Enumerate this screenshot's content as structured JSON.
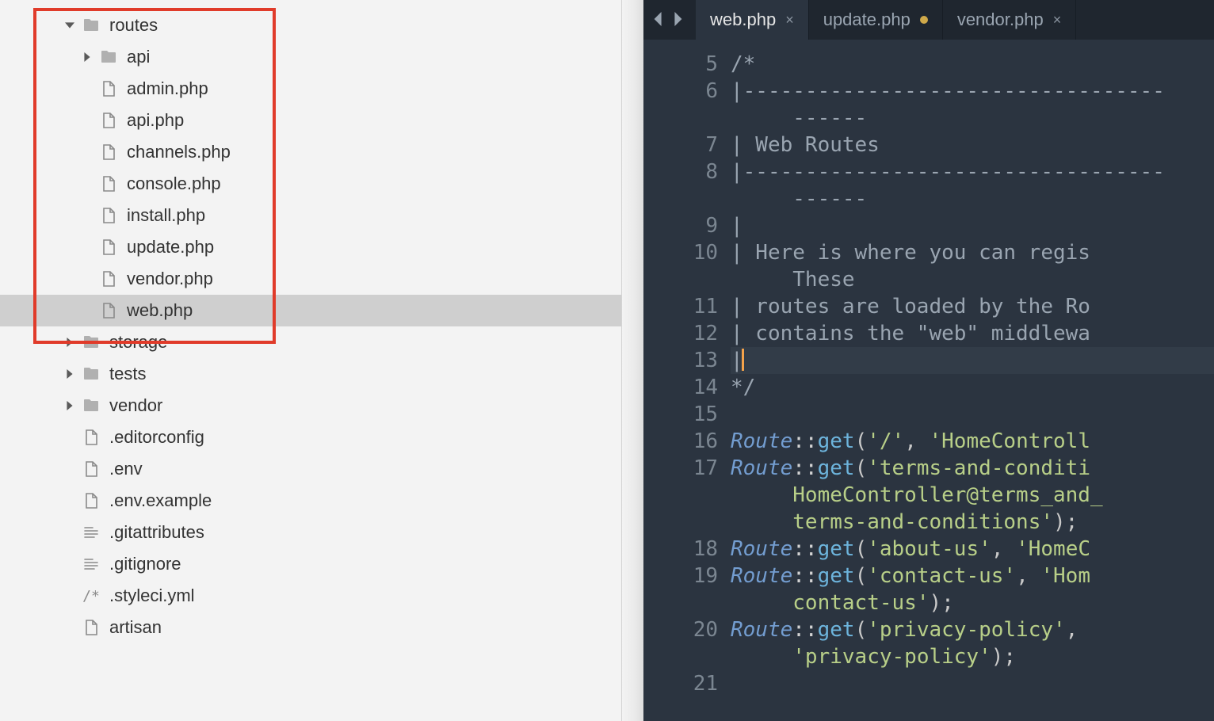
{
  "sidebar": {
    "tree": [
      {
        "depth": 2,
        "type": "folder",
        "expanded": true,
        "name": "routes"
      },
      {
        "depth": 3,
        "type": "folder",
        "expanded": false,
        "name": "api"
      },
      {
        "depth": 3,
        "type": "file",
        "name": "admin.php"
      },
      {
        "depth": 3,
        "type": "file",
        "name": "api.php"
      },
      {
        "depth": 3,
        "type": "file",
        "name": "channels.php"
      },
      {
        "depth": 3,
        "type": "file",
        "name": "console.php"
      },
      {
        "depth": 3,
        "type": "file",
        "name": "install.php"
      },
      {
        "depth": 3,
        "type": "file",
        "name": "update.php"
      },
      {
        "depth": 3,
        "type": "file",
        "name": "vendor.php"
      },
      {
        "depth": 3,
        "type": "file",
        "name": "web.php",
        "selected": true
      },
      {
        "depth": 2,
        "type": "folder",
        "expanded": false,
        "name": "storage"
      },
      {
        "depth": 2,
        "type": "folder",
        "expanded": false,
        "name": "tests"
      },
      {
        "depth": 2,
        "type": "folder",
        "expanded": false,
        "name": "vendor"
      },
      {
        "depth": 2,
        "type": "file",
        "name": ".editorconfig"
      },
      {
        "depth": 2,
        "type": "file",
        "name": ".env"
      },
      {
        "depth": 2,
        "type": "file",
        "name": ".env.example"
      },
      {
        "depth": 2,
        "type": "lines",
        "name": ".gitattributes"
      },
      {
        "depth": 2,
        "type": "lines",
        "name": ".gitignore"
      },
      {
        "depth": 2,
        "type": "text",
        "name": ".styleci.yml",
        "prefix": "/*"
      },
      {
        "depth": 2,
        "type": "file",
        "name": "artisan"
      }
    ]
  },
  "tabs": {
    "items": [
      {
        "label": "web.php",
        "active": true,
        "dirty": false
      },
      {
        "label": "update.php",
        "active": false,
        "dirty": true
      },
      {
        "label": "vendor.php",
        "active": false,
        "dirty": false
      }
    ]
  },
  "editor": {
    "lines": [
      {
        "n": 5,
        "segments": [
          {
            "cls": "tk-comment",
            "text": "/*"
          }
        ]
      },
      {
        "n": 6,
        "segments": [
          {
            "cls": "tk-comment",
            "text": "|----------------------------------"
          }
        ],
        "wrap": [
          {
            "cls": "tk-comment",
            "text": "------"
          }
        ]
      },
      {
        "n": 7,
        "segments": [
          {
            "cls": "tk-comment",
            "text": "| Web Routes"
          }
        ]
      },
      {
        "n": 8,
        "segments": [
          {
            "cls": "tk-comment",
            "text": "|----------------------------------"
          }
        ],
        "wrap": [
          {
            "cls": "tk-comment",
            "text": "------"
          }
        ]
      },
      {
        "n": 9,
        "segments": [
          {
            "cls": "tk-comment",
            "text": "|"
          }
        ]
      },
      {
        "n": 10,
        "segments": [
          {
            "cls": "tk-comment",
            "text": "| Here is where you can regis"
          }
        ],
        "wrap": [
          {
            "cls": "tk-comment",
            "text": "These"
          }
        ]
      },
      {
        "n": 11,
        "segments": [
          {
            "cls": "tk-comment",
            "text": "| routes are loaded by the Ro"
          }
        ]
      },
      {
        "n": 12,
        "segments": [
          {
            "cls": "tk-comment",
            "text": "| contains the \"web\" middlewa"
          }
        ]
      },
      {
        "n": 13,
        "current": true,
        "segments": [
          {
            "cls": "tk-comment",
            "text": "|"
          },
          {
            "cursor": true
          }
        ]
      },
      {
        "n": 14,
        "segments": [
          {
            "cls": "tk-comment",
            "text": "*/"
          }
        ]
      },
      {
        "n": 15,
        "segments": [
          {
            "cls": "",
            "text": ""
          }
        ]
      },
      {
        "n": 16,
        "segments": [
          {
            "cls": "tk-class",
            "text": "Route"
          },
          {
            "cls": "tk-op",
            "text": "::"
          },
          {
            "cls": "tk-method",
            "text": "get"
          },
          {
            "cls": "tk-punct",
            "text": "("
          },
          {
            "cls": "tk-string",
            "text": "'/'"
          },
          {
            "cls": "tk-punct",
            "text": ", "
          },
          {
            "cls": "tk-string",
            "text": "'HomeControll"
          }
        ]
      },
      {
        "n": 17,
        "segments": [
          {
            "cls": "tk-class",
            "text": "Route"
          },
          {
            "cls": "tk-op",
            "text": "::"
          },
          {
            "cls": "tk-method",
            "text": "get"
          },
          {
            "cls": "tk-punct",
            "text": "("
          },
          {
            "cls": "tk-string",
            "text": "'terms-and-conditi"
          }
        ],
        "wrap": [
          {
            "cls": "tk-string",
            "text": "HomeController@terms_and_"
          }
        ],
        "wrap2": [
          {
            "cls": "tk-string",
            "text": "terms-and-conditions'"
          },
          {
            "cls": "tk-punct",
            "text": ");"
          }
        ]
      },
      {
        "n": 18,
        "segments": [
          {
            "cls": "tk-class",
            "text": "Route"
          },
          {
            "cls": "tk-op",
            "text": "::"
          },
          {
            "cls": "tk-method",
            "text": "get"
          },
          {
            "cls": "tk-punct",
            "text": "("
          },
          {
            "cls": "tk-string",
            "text": "'about-us'"
          },
          {
            "cls": "tk-punct",
            "text": ", "
          },
          {
            "cls": "tk-string",
            "text": "'HomeC"
          }
        ]
      },
      {
        "n": 19,
        "segments": [
          {
            "cls": "tk-class",
            "text": "Route"
          },
          {
            "cls": "tk-op",
            "text": "::"
          },
          {
            "cls": "tk-method",
            "text": "get"
          },
          {
            "cls": "tk-punct",
            "text": "("
          },
          {
            "cls": "tk-string",
            "text": "'contact-us'"
          },
          {
            "cls": "tk-punct",
            "text": ", "
          },
          {
            "cls": "tk-string",
            "text": "'Hom"
          }
        ],
        "wrap": [
          {
            "cls": "tk-string",
            "text": "contact-us'"
          },
          {
            "cls": "tk-punct",
            "text": ");"
          }
        ]
      },
      {
        "n": 20,
        "segments": [
          {
            "cls": "tk-class",
            "text": "Route"
          },
          {
            "cls": "tk-op",
            "text": "::"
          },
          {
            "cls": "tk-method",
            "text": "get"
          },
          {
            "cls": "tk-punct",
            "text": "("
          },
          {
            "cls": "tk-string",
            "text": "'privacy-policy'"
          },
          {
            "cls": "tk-punct",
            "text": ","
          }
        ],
        "wrap": [
          {
            "cls": "tk-string",
            "text": "'privacy-policy'"
          },
          {
            "cls": "tk-punct",
            "text": ");"
          }
        ]
      },
      {
        "n": 21,
        "segments": [
          {
            "cls": "",
            "text": ""
          }
        ]
      }
    ]
  }
}
